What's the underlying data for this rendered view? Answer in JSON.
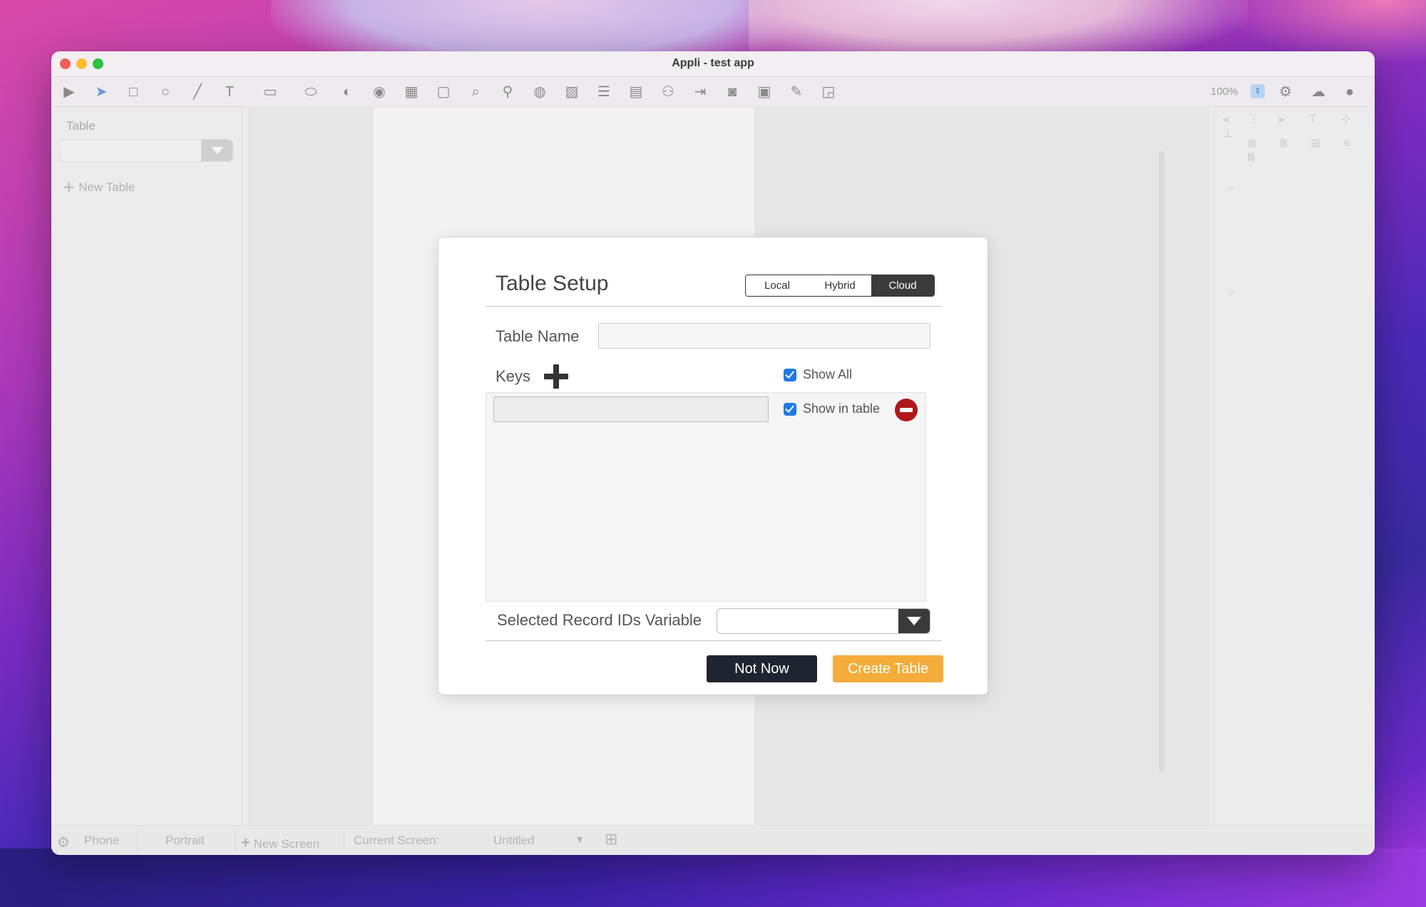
{
  "window": {
    "title": "Appli - test app"
  },
  "toolbar": {
    "tools": [
      "play-icon",
      "pointer-icon",
      "rectangle-icon",
      "circle-icon",
      "line-icon",
      "text-icon",
      "textfield-icon",
      "button-icon",
      "toggle-icon",
      "radio-icon",
      "grid-icon",
      "page-icon",
      "search-icon",
      "map-pin-icon",
      "globe-icon",
      "image-icon",
      "list-icon",
      "form-icon",
      "add-user-icon",
      "login-icon",
      "camera-icon",
      "video-icon",
      "edit-icon",
      "chart-icon"
    ],
    "zoom": "100%"
  },
  "left_panel": {
    "label": "Table",
    "new_table": "New Table"
  },
  "statusbar": {
    "device": "Phone",
    "orientation": "Portrait",
    "new_screen": "New Screen",
    "current_screen_label": "Current Screen:",
    "current_screen_value": "Untitled"
  },
  "modal": {
    "title": "Table Setup",
    "segments": [
      {
        "label": "Local",
        "active": false
      },
      {
        "label": "Hybrid",
        "active": false
      },
      {
        "label": "Cloud",
        "active": true
      }
    ],
    "table_name_label": "Table Name",
    "table_name_value": "",
    "keys_label": "Keys",
    "show_all_label": "Show All",
    "show_all_checked": true,
    "key_row": {
      "value": "",
      "show_in_table_label": "Show in table",
      "checked": true
    },
    "selected_var_label": "Selected Record IDs Variable",
    "selected_var_value": "",
    "not_now_label": "Not Now",
    "create_label": "Create Table",
    "colors": {
      "create": "#f4ac3a",
      "not_now": "#1f2530",
      "check": "#1f7ae8",
      "remove": "#b01818"
    }
  }
}
